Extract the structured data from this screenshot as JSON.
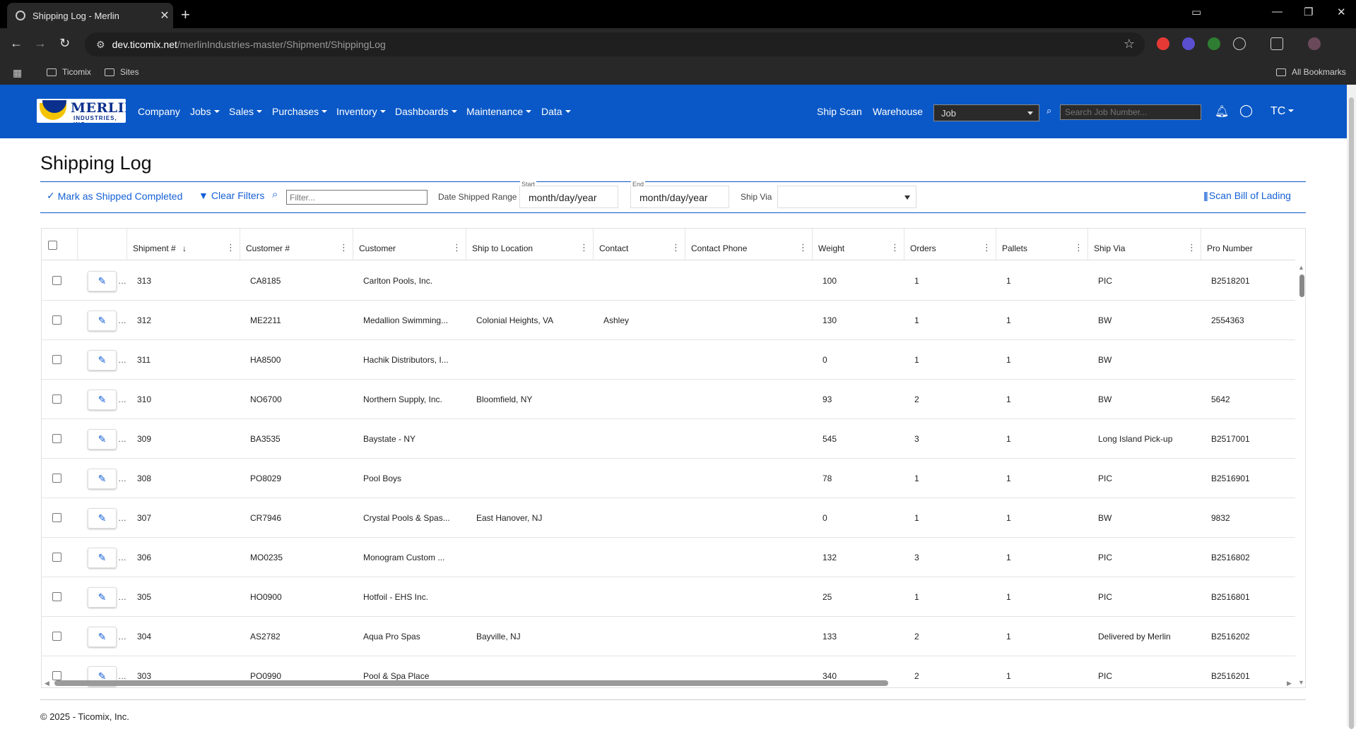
{
  "browser": {
    "tab_title": "Shipping Log - Merlin",
    "url_host": "dev.ticomix.net",
    "url_path": "/merlinIndustries-master/Shipment/ShippingLog",
    "bookmarks": [
      "Ticomix",
      "Sites"
    ],
    "all_bookmarks": "All Bookmarks"
  },
  "nav": {
    "logo_text": "MERLIN",
    "logo_sub": "INDUSTRIES, INC.",
    "menus": [
      "Company",
      "Jobs",
      "Sales",
      "Purchases",
      "Inventory",
      "Dashboards",
      "Maintenance",
      "Data"
    ],
    "ship_scan": "Ship Scan",
    "warehouse": "Warehouse",
    "job_select": "Job",
    "search_placeholder": "Search Job Number...",
    "user_initials": "TC"
  },
  "page": {
    "title": "Shipping Log",
    "mark_shipped": "Mark as Shipped Completed",
    "clear_filters": "Clear Filters",
    "filter_placeholder": "Filter...",
    "date_range_label": "Date Shipped Range",
    "start_label": "Start",
    "end_label": "End",
    "date_placeholder": "month/day/year",
    "ship_via_label": "Ship Via",
    "scan_bol": "Scan Bill of Lading",
    "footer": "© 2025 - Ticomix, Inc."
  },
  "grid": {
    "headers": [
      "Shipment #",
      "Customer #",
      "Customer",
      "Ship to Location",
      "Contact",
      "Contact Phone",
      "Weight",
      "Orders",
      "Pallets",
      "Ship Via",
      "Pro Number"
    ],
    "sort_indicator": "↓",
    "rows": [
      {
        "shipment": "313",
        "customer_no": "CA8185",
        "customer": "Carlton Pools, Inc.",
        "location": "",
        "contact": "",
        "phone": "",
        "weight": "100",
        "orders": "1",
        "pallets": "1",
        "ship_via": "PIC",
        "pro": "B2518201"
      },
      {
        "shipment": "312",
        "customer_no": "ME2211",
        "customer": "Medallion Swimming...",
        "location": "Colonial Heights, VA",
        "contact": "Ashley",
        "phone": "",
        "weight": "130",
        "orders": "1",
        "pallets": "1",
        "ship_via": "BW",
        "pro": "2554363"
      },
      {
        "shipment": "311",
        "customer_no": "HA8500",
        "customer": "Hachik Distributors, I...",
        "location": "",
        "contact": "",
        "phone": "",
        "weight": "0",
        "orders": "1",
        "pallets": "1",
        "ship_via": "BW",
        "pro": ""
      },
      {
        "shipment": "310",
        "customer_no": "NO6700",
        "customer": "Northern Supply, Inc.",
        "location": "Bloomfield, NY",
        "contact": "",
        "phone": "",
        "weight": "93",
        "orders": "2",
        "pallets": "1",
        "ship_via": "BW",
        "pro": "5642"
      },
      {
        "shipment": "309",
        "customer_no": "BA3535",
        "customer": "Baystate - NY",
        "location": "",
        "contact": "",
        "phone": "",
        "weight": "545",
        "orders": "3",
        "pallets": "1",
        "ship_via": "Long Island Pick-up",
        "pro": "B2517001"
      },
      {
        "shipment": "308",
        "customer_no": "PO8029",
        "customer": "Pool Boys",
        "location": "",
        "contact": "",
        "phone": "",
        "weight": "78",
        "orders": "1",
        "pallets": "1",
        "ship_via": "PIC",
        "pro": "B2516901"
      },
      {
        "shipment": "307",
        "customer_no": "CR7946",
        "customer": "Crystal Pools & Spas...",
        "location": "East Hanover, NJ",
        "contact": "",
        "phone": "",
        "weight": "0",
        "orders": "1",
        "pallets": "1",
        "ship_via": "BW",
        "pro": "9832"
      },
      {
        "shipment": "306",
        "customer_no": "MO0235",
        "customer": "Monogram Custom ...",
        "location": "",
        "contact": "",
        "phone": "",
        "weight": "132",
        "orders": "3",
        "pallets": "1",
        "ship_via": "PIC",
        "pro": "B2516802"
      },
      {
        "shipment": "305",
        "customer_no": "HO0900",
        "customer": "Hotfoil - EHS Inc.",
        "location": "",
        "contact": "",
        "phone": "",
        "weight": "25",
        "orders": "1",
        "pallets": "1",
        "ship_via": "PIC",
        "pro": "B2516801"
      },
      {
        "shipment": "304",
        "customer_no": "AS2782",
        "customer": "Aqua Pro Spas",
        "location": "Bayville, NJ",
        "contact": "",
        "phone": "",
        "weight": "133",
        "orders": "2",
        "pallets": "1",
        "ship_via": "Delivered by Merlin",
        "pro": "B2516202"
      },
      {
        "shipment": "303",
        "customer_no": "PO0990",
        "customer": "Pool & Spa Place",
        "location": "",
        "contact": "",
        "phone": "",
        "weight": "340",
        "orders": "2",
        "pallets": "1",
        "ship_via": "PIC",
        "pro": "B2516201"
      }
    ]
  }
}
